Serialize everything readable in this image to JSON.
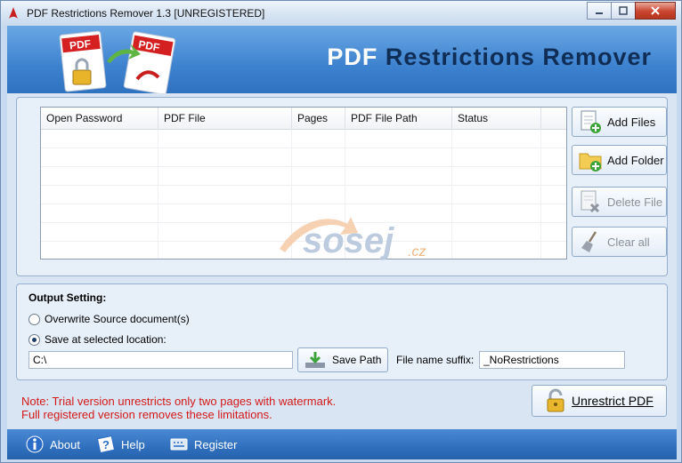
{
  "window": {
    "title": "PDF Restrictions Remover 1.3 [UNREGISTERED]"
  },
  "banner": {
    "brand_part1": "PDF",
    "brand_part2": "Restrictions Remover"
  },
  "file_list": {
    "columns": [
      "Open Password",
      "PDF File",
      "Pages",
      "PDF File Path",
      "Status"
    ],
    "rows": []
  },
  "side_buttons": {
    "add_files": "Add Files",
    "add_folder": "Add Folder",
    "delete_file": "Delete File",
    "clear_all": "Clear all"
  },
  "output": {
    "title": "Output Setting:",
    "option_overwrite": "Overwrite Source document(s)",
    "option_save": "Save at selected location:",
    "selected_option": "save",
    "path_value": "C:\\",
    "save_path_label": "Save Path",
    "suffix_label": "File name suffix:",
    "suffix_value": "_NoRestrictions"
  },
  "note": {
    "line1": "Note: Trial version unrestricts only two pages with watermark.",
    "line2": "Full registered version removes these limitations."
  },
  "unrestrict_label": "Unrestrict PDF",
  "bottom_bar": {
    "about": "About",
    "help": "Help",
    "register": "Register"
  },
  "colors": {
    "note": "#d41818",
    "banner": "#3d82cf",
    "brand_dark": "#0f2d55"
  }
}
